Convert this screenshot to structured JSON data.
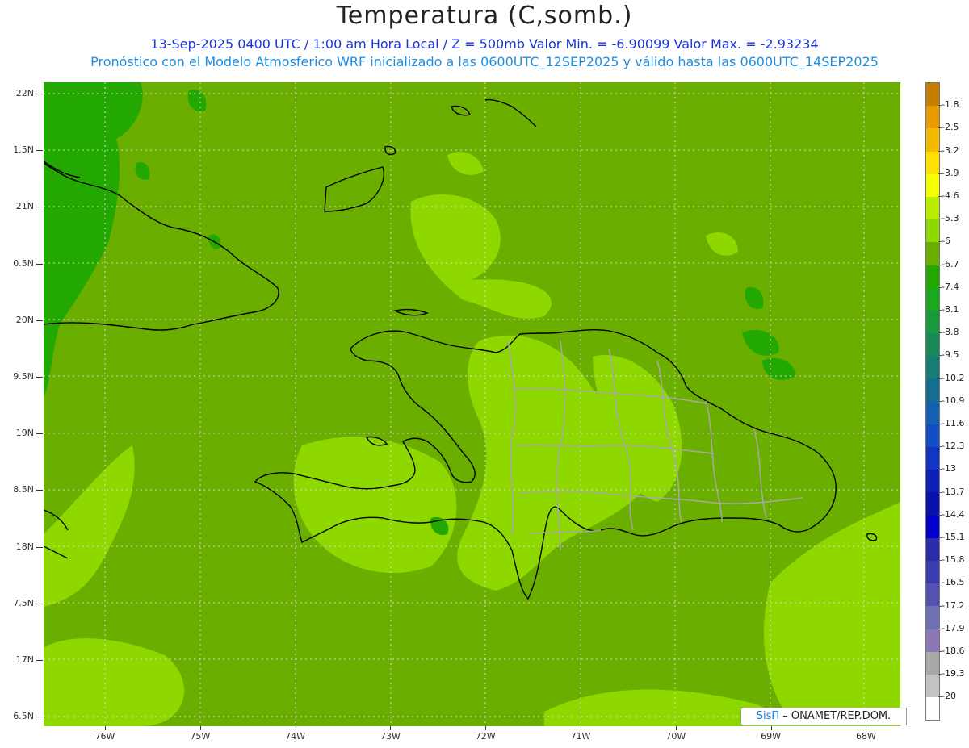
{
  "title": "Temperatura (C,somb.)",
  "subtitle_line1": "13-Sep-2025  0400 UTC / 1:00 am Hora Local / Z = 500mb  Valor Min. = -6.90099  Valor Max. = -2.93234",
  "subtitle_line2": "Pronóstico con el Modelo Atmosferico WRF inicializado a las 0600UTC_12SEP2025 y válido hasta las  0600UTC_14SEP2025",
  "credit": {
    "sis": "SisΠ",
    "rest": " – ONAMET/REP.DOM."
  },
  "lat_labels": [
    "22N",
    "1.5N",
    "21N",
    "0.5N",
    "20N",
    "9.5N",
    "19N",
    "8.5N",
    "18N",
    "7.5N",
    "17N",
    "6.5N"
  ],
  "lon_labels": [
    "76W",
    "75W",
    "74W",
    "73W",
    "72W",
    "71W",
    "70W",
    "69W",
    "68W"
  ],
  "legend": {
    "labels": [
      "-1.8",
      "-2.5",
      "-3.2",
      "-3.9",
      "-4.6",
      "-5.3",
      "-6",
      "-6.7",
      "-7.4",
      "-8.1",
      "-8.8",
      "-9.5",
      "-10.2",
      "-10.9",
      "-11.6",
      "-12.3",
      "-13",
      "-13.7",
      "-14.4",
      "-15.1",
      "-15.8",
      "-16.5",
      "-17.2",
      "-17.9",
      "-18.6",
      "-19.3",
      "-20"
    ],
    "colors": [
      "#c57e00",
      "#e89a00",
      "#f4ba00",
      "#ffe000",
      "#f4ff00",
      "#b8ec00",
      "#8ed800",
      "#6aae00",
      "#22a800",
      "#1aa81e",
      "#1a9a3c",
      "#198b58",
      "#177d75",
      "#166e8f",
      "#1560b0",
      "#134dc6",
      "#1236c2",
      "#0d20b8",
      "#0a10aa",
      "#0000c8",
      "#2c2caa",
      "#3b3bb0",
      "#5454b0",
      "#7070b4",
      "#8c78b4",
      "#a8a8a8",
      "#c4c4c4",
      "#ffffff"
    ]
  },
  "colors": {
    "background_field": "#6aae00",
    "light_field": "#8ed800",
    "dark_field": "#22a800",
    "coastline": "#000000",
    "province_borders": "#a8a8a8"
  }
}
